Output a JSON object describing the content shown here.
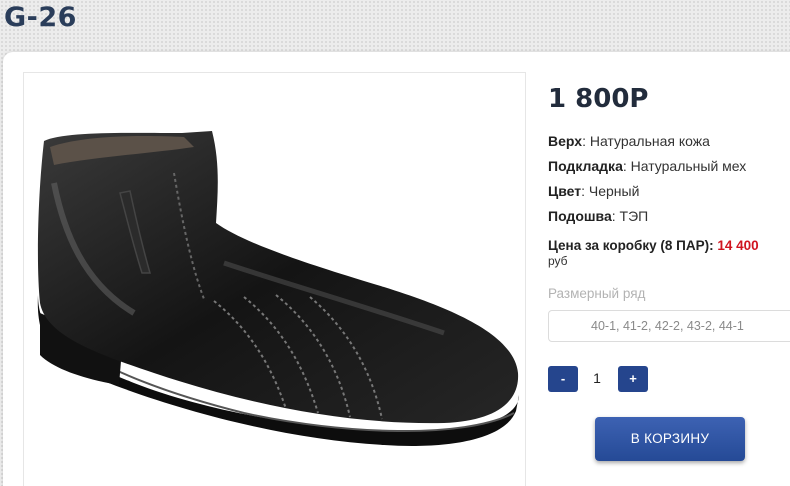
{
  "product": {
    "title": "G-26",
    "price": "1 800Р",
    "specs": [
      {
        "label": "Верх",
        "value": "Натуральная кожа"
      },
      {
        "label": "Подкладка",
        "value": "Натуральный мех"
      },
      {
        "label": "Цвет",
        "value": "Черный"
      },
      {
        "label": "Подошва",
        "value": "ТЭП"
      }
    ],
    "box_price_label": "Цена за коробку (8 ПАР):",
    "box_price_value": "14 400",
    "box_price_currency": "руб",
    "size_label": "Размерный ряд",
    "sizes": "40-1, 41-2, 42-2, 43-2, 44-1",
    "image_alt": "black leather ankle boot"
  },
  "quantity": {
    "minus_label": "-",
    "value": "1",
    "plus_label": "+"
  },
  "cart_button_label": "В КОРЗИНУ",
  "colors": {
    "title": "#2a3d5a",
    "button": "#25458d",
    "box_price": "#d0141f"
  }
}
